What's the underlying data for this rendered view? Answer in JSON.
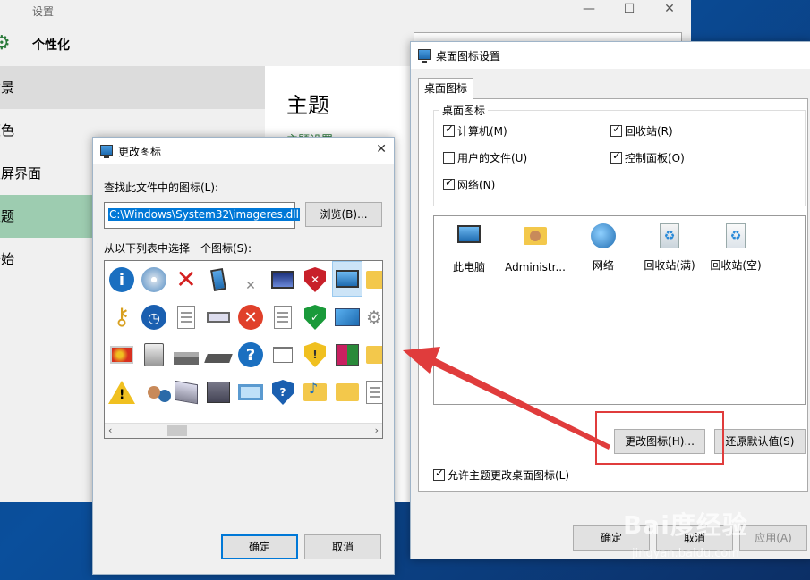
{
  "settings": {
    "title": "设置",
    "header": "个性化",
    "nav": [
      "背景",
      "颜色",
      "锁屏界面",
      "主题",
      "开始"
    ],
    "main_title": "主题",
    "main_link": "主题设置"
  },
  "desktop_icons_dialog": {
    "title": "桌面图标设置",
    "tab": "桌面图标",
    "group_label": "桌面图标",
    "checkboxes": [
      {
        "label": "计算机(M)",
        "checked": true
      },
      {
        "label": "回收站(R)",
        "checked": true
      },
      {
        "label": "用户的文件(U)",
        "checked": false
      },
      {
        "label": "控制面板(O)",
        "checked": true
      },
      {
        "label": "网络(N)",
        "checked": true
      }
    ],
    "icons": [
      "此电脑",
      "Administr...",
      "网络",
      "回收站(满)",
      "回收站(空)"
    ],
    "change_icon_button": "更改图标(H)...",
    "restore_default_button": "还原默认值(S)",
    "allow_themes_checkbox": {
      "label": "允许主题更改桌面图标(L)",
      "checked": true
    },
    "ok_button": "确定",
    "cancel_button": "取消",
    "apply_button": "应用(A)"
  },
  "change_icon_dialog": {
    "title": "更改图标",
    "find_label": "查找此文件中的图标(L):",
    "path_value": "C:\\Windows\\System32\\imageres.dll",
    "browse_button": "浏览(B)...",
    "select_label": "从以下列表中选择一个图标(S):",
    "ok_button": "确定",
    "cancel_button": "取消"
  },
  "watermark": {
    "text": "Bai度经验",
    "sub": "jingyan.baidu.com"
  },
  "colors": {
    "accent": "#0078d7",
    "highlight_red": "#e03c3c",
    "nav_selected": "#9dccb0"
  }
}
